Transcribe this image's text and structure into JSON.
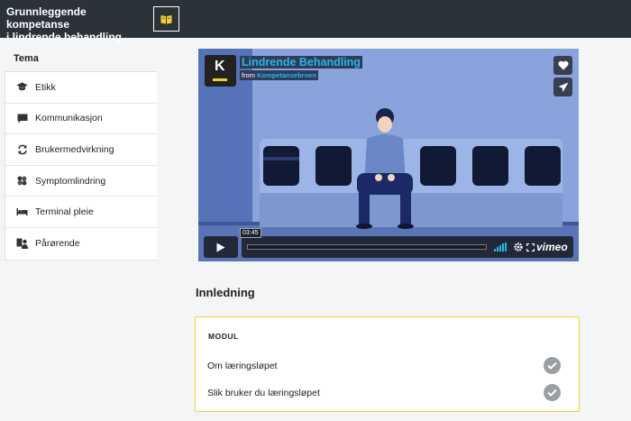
{
  "header": {
    "title_line1": "Grunnleggende kompetanse",
    "title_line2": "i lindrende behandling",
    "book_icon": "book-icon",
    "accent": "#f5d02e"
  },
  "sidebar": {
    "heading": "Tema",
    "items": [
      {
        "label": "Etikk",
        "icon": "graduation-cap-icon"
      },
      {
        "label": "Kommunikasjon",
        "icon": "speech-bubble-icon"
      },
      {
        "label": "Brukermedvirkning",
        "icon": "refresh-arrows-icon"
      },
      {
        "label": "Symptomlindring",
        "icon": "bandage-icon"
      },
      {
        "label": "Terminal pleie",
        "icon": "bed-icon"
      },
      {
        "label": "Pårørende",
        "icon": "people-icon"
      }
    ]
  },
  "video": {
    "title": "Lindrende Behandling",
    "from_prefix": "from",
    "from_channel": "Kompetansebroen",
    "logo_letter": "K",
    "timecode": "03:45",
    "brand": "vimeo",
    "colors": {
      "title": "#25b7e8",
      "background": "#6b87c9"
    }
  },
  "main": {
    "section_title": "Innledning",
    "module": {
      "label": "MODUL",
      "items": [
        {
          "label": "Om læringsløpet",
          "completed": true
        },
        {
          "label": "Slik bruker du læringsløpet",
          "completed": true
        }
      ]
    }
  }
}
